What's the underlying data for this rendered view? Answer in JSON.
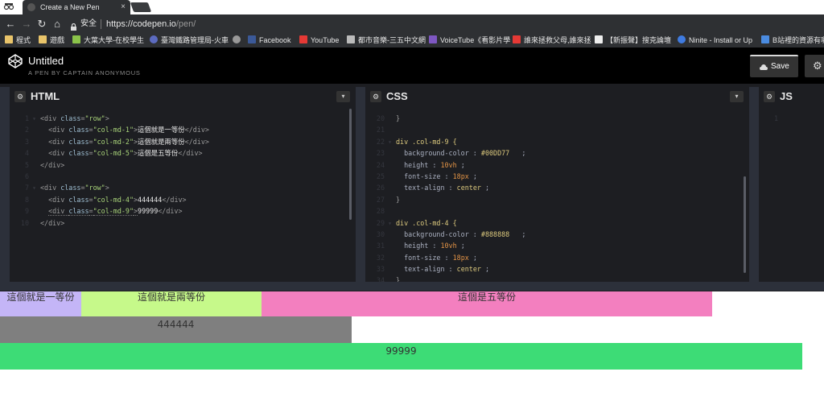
{
  "browser": {
    "tab_title": "Create a New Pen",
    "tab_close": "×",
    "secure_label": "安全",
    "url_host": "https://codepen.io",
    "url_path": "/pen/",
    "bookmarks": [
      "程式",
      "遊戲",
      "大葉大學-在校學生",
      "臺灣鐵路管理局-火車",
      "",
      "Facebook",
      "YouTube",
      "都市音樂-三五中文網",
      "VoiceTube《看影片學",
      "誰來拯救父母,誰來拯",
      "【新振聲】搜克論壇",
      "Ninite - Install or Up",
      "B站裡的資源有哪些"
    ]
  },
  "codepen": {
    "title": "Untitled",
    "subtitle": "A PEN BY CAPTAIN ANONYMOUS",
    "save_label": "Save"
  },
  "panes": {
    "html_label": "HTML",
    "css_label": "CSS",
    "js_label": "JS"
  },
  "html_code": {
    "line_numbers": [
      "1",
      "2",
      "3",
      "4",
      "5",
      "6",
      "7",
      "8",
      "9",
      "10"
    ],
    "text_1": "這個就是一等份",
    "text_2": "這個就是兩等份",
    "text_5": "這個是五等份",
    "text_4": "444444",
    "text_9": "99999"
  },
  "css_code": {
    "line_numbers": [
      "20",
      "21",
      "22",
      "23",
      "24",
      "25",
      "26",
      "27",
      "28",
      "29",
      "30",
      "31",
      "32",
      "33",
      "34"
    ],
    "color_1": "#00DD77",
    "color_2": "#888888",
    "height": "10vh",
    "font_size": "18px",
    "align": "center"
  },
  "js_code": {
    "line_numbers": [
      "1"
    ]
  },
  "preview": {
    "col1": "這個就是一等份",
    "col2": "這個就是兩等份",
    "col5": "這個是五等份",
    "col4": "444444",
    "col9": "99999"
  },
  "colors": {
    "col1_bg": "#c4b5f7",
    "col2_bg": "#c6f98a",
    "col5_bg": "#f37fbf",
    "col4_bg": "#7f7f7f",
    "col9_bg": "#3ddc76"
  }
}
